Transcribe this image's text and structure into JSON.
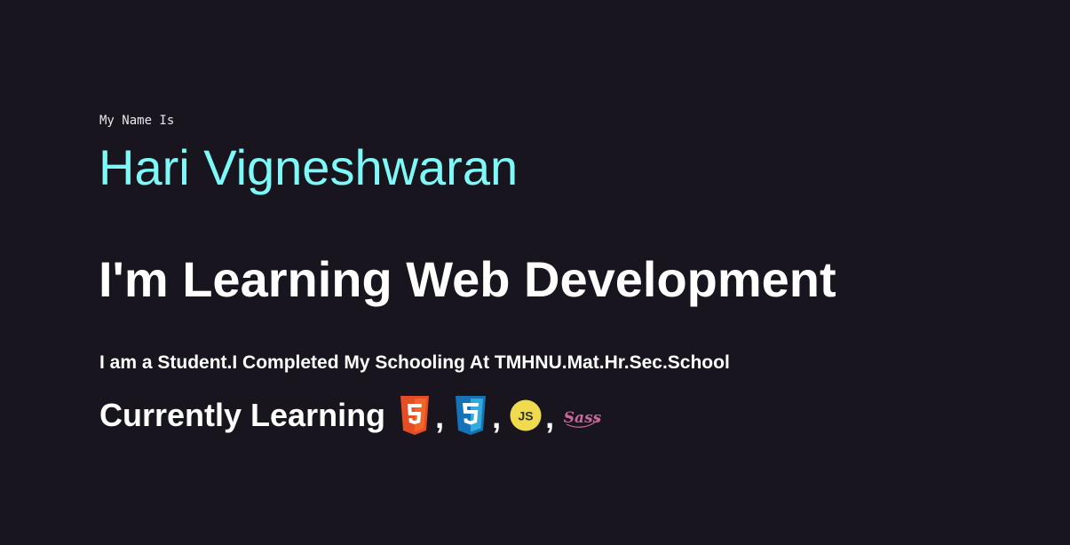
{
  "intro": {
    "label": "My Name Is",
    "name": "Hari Vigneshwaran"
  },
  "headline": "I'm Learning Web Development",
  "bio": "I am a Student.I Completed My Schooling At TMHNU.Mat.Hr.Sec.School",
  "learning": {
    "label": "Currently Learning",
    "separator": ",",
    "technologies": [
      {
        "icon": "html5-icon",
        "color": "#e44d26"
      },
      {
        "icon": "css3-icon",
        "color": "#1572b6"
      },
      {
        "icon": "javascript-icon",
        "color": "#f0db4f",
        "text": "JS"
      },
      {
        "icon": "sass-icon",
        "color": "#cd6799",
        "text": "Sass"
      }
    ]
  },
  "colors": {
    "background": "#18151f",
    "name": "#7ef9f7",
    "text": "#ffffff"
  }
}
